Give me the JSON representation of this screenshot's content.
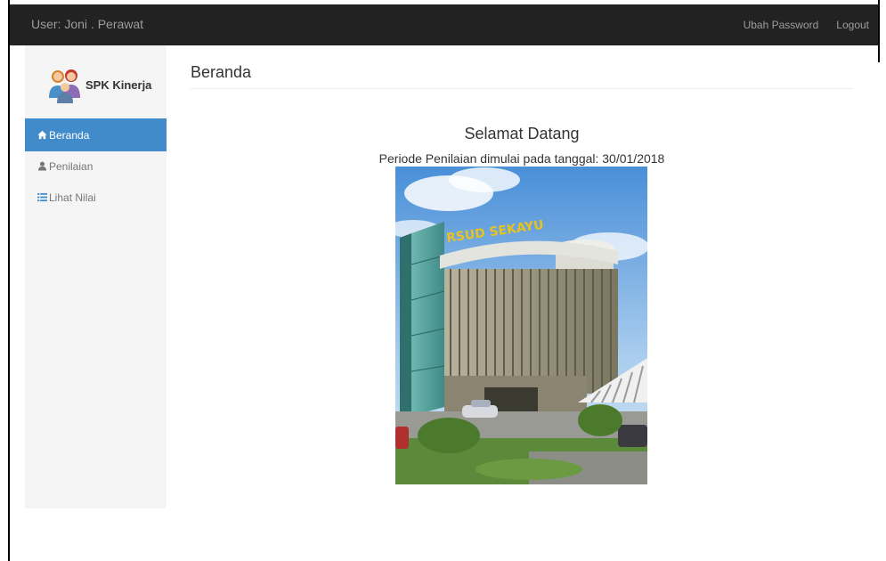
{
  "navbar": {
    "user_label": "User: Joni . Perawat",
    "change_password": "Ubah Password",
    "logout": "Logout"
  },
  "sidebar": {
    "brand": "SPK Kinerja",
    "items": [
      {
        "label": "Beranda",
        "icon": "home-icon",
        "active": true
      },
      {
        "label": "Penilaian",
        "icon": "user-icon",
        "active": false
      },
      {
        "label": "Lihat Nilai",
        "icon": "list-icon",
        "active": false
      }
    ]
  },
  "main": {
    "page_title": "Beranda",
    "welcome": "Selamat Datang",
    "periode": "Periode Penilaian dimulai pada tanggal: 30/01/2018",
    "hero_sign": "RSUD SEKAYU"
  },
  "colors": {
    "navbar_bg": "#222222",
    "navbar_text": "#9d9d9d",
    "sidebar_bg": "#f5f5f5",
    "active_bg": "#428bca"
  }
}
